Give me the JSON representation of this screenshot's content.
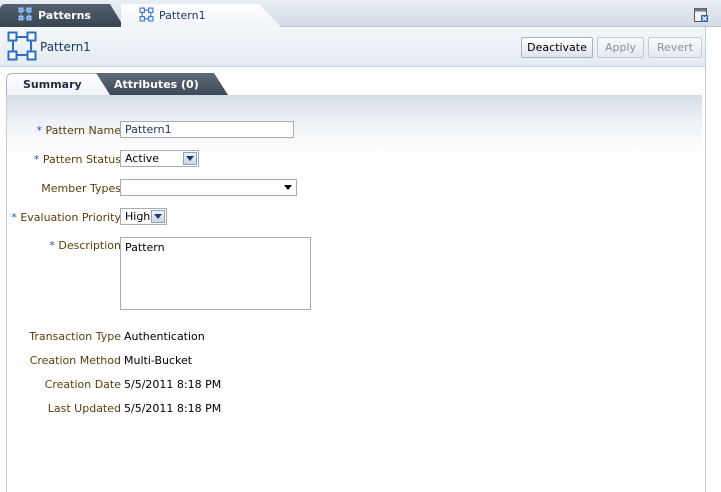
{
  "tabs": {
    "patterns_label": "Patterns",
    "pattern1_label": "Pattern1"
  },
  "header": {
    "title": "Pattern1",
    "deactivate_label": "Deactivate",
    "apply_label": "Apply",
    "revert_label": "Revert"
  },
  "subtabs": {
    "summary_label": "Summary",
    "attributes_label": "Attributes (0)"
  },
  "form": {
    "required_marker": "*",
    "pattern_name_label": "Pattern Name",
    "pattern_name_value": "Pattern1",
    "pattern_status_label": "Pattern Status",
    "pattern_status_value": "Active",
    "member_types_label": "Member Types",
    "member_types_value": "",
    "evaluation_priority_label": "Evaluation Priority",
    "evaluation_priority_value": "High",
    "description_label": "Description",
    "description_value": "Pattern",
    "transaction_type_label": "Transaction Type",
    "transaction_type_value": "Authentication",
    "creation_method_label": "Creation Method",
    "creation_method_value": "Multi-Bucket",
    "creation_date_label": "Creation Date",
    "creation_date_value": "5/5/2011 8:18 PM",
    "last_updated_label": "Last Updated",
    "last_updated_value": "5/5/2011 8:18 PM"
  },
  "colors": {
    "label_brown": "#5a3e0a",
    "required_blue": "#2b5aa8",
    "title_blue": "#1c3b63"
  },
  "icons": [
    "pattern-icon",
    "close-tab-icon",
    "dropdown-arrow-icon"
  ]
}
